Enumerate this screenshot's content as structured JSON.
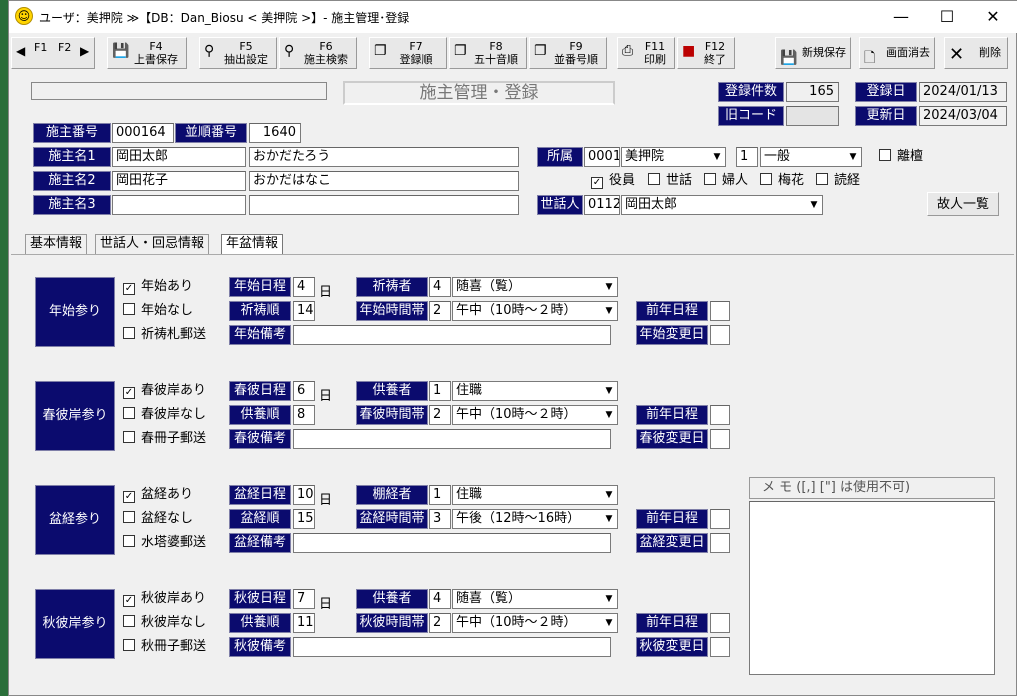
{
  "window": {
    "title": "ユーザ：美押院 ≫【DB：Dan_Biosu < 美押院 >】- 施主管理･登録",
    "controls": {
      "minimize": "—",
      "maximize": "☐",
      "close": "✕"
    }
  },
  "toolbar": {
    "nav": {
      "prev_arrow": "◀",
      "f1": "F1",
      "f2": "F2",
      "next_arrow": "▶"
    },
    "buttons": [
      {
        "key": "F4",
        "label": "上書保存",
        "icon": "save-icon"
      },
      {
        "key": "F5",
        "label": "抽出設定",
        "icon": "binoculars-icon"
      },
      {
        "key": "F6",
        "label": "施主検索",
        "icon": "binoculars-icon"
      },
      {
        "key": "F7",
        "label": "登録順",
        "icon": "copy-icon"
      },
      {
        "key": "F8",
        "label": "五十音順",
        "icon": "copy-icon"
      },
      {
        "key": "F9",
        "label": "並番号順",
        "icon": "copy-icon"
      },
      {
        "key": "F11",
        "label": "印刷",
        "icon": "printer-icon"
      },
      {
        "key": "F12",
        "label": "終了",
        "icon": "exit-icon"
      }
    ],
    "new_save": "新規保存",
    "clear_screen": "画面消去",
    "delete": "削除"
  },
  "header": {
    "screen_title": "施主管理・登録",
    "count_label": "登録件数",
    "count_value": "165",
    "old_code_label": "旧コード",
    "old_code_value": "",
    "registered_label": "登録日",
    "registered_value": "2024/01/13",
    "updated_label": "更新日",
    "updated_value": "2024/03/04"
  },
  "owner": {
    "number_label": "施主番号",
    "number_value": "000164",
    "order_label": "並順番号",
    "order_value": "1640",
    "name1_label": "施主名1",
    "name1_value": "岡田太郎",
    "name1_kana": "おかだたろう",
    "name2_label": "施主名2",
    "name2_value": "岡田花子",
    "name2_kana": "おかだはなこ",
    "name3_label": "施主名3",
    "name3_value": "",
    "name3_kana": "",
    "affiliation_label": "所属",
    "affiliation_code": "0001",
    "affiliation_name": "美押院",
    "class_code": "1",
    "class_name": "一般",
    "separated_label": "離檀",
    "roles": [
      {
        "label": "役員",
        "checked": true
      },
      {
        "label": "世話",
        "checked": false
      },
      {
        "label": "婦人",
        "checked": false
      },
      {
        "label": "梅花",
        "checked": false
      },
      {
        "label": "読経",
        "checked": false
      }
    ],
    "caretaker_label": "世話人",
    "caretaker_code": "0112",
    "caretaker_name": "岡田太郎",
    "deceased_list_button": "故人一覧"
  },
  "tabs": [
    "基本情報",
    "世話人・回忌情報",
    "年盆情報"
  ],
  "day_unit": "日",
  "sections": [
    {
      "label": "年始参り",
      "checks": [
        {
          "label": "年始あり",
          "checked": true
        },
        {
          "label": "年始なし",
          "checked": false
        },
        {
          "label": "祈祷札郵送",
          "checked": false
        }
      ],
      "date_label": "年始日程",
      "date_value": "4",
      "order_label": "祈祷順",
      "order_value": "14",
      "note_label": "年始備考",
      "note_value": "",
      "person_label": "祈祷者",
      "person_code": "4",
      "person_name": "随喜（覧）",
      "time_label": "年始時間帯",
      "time_code": "2",
      "time_value": "午中（10時～２時）",
      "prev_label": "前年日程",
      "prev_value": "",
      "change_label": "年始変更日",
      "change_value": ""
    },
    {
      "label": "春彼岸参り",
      "checks": [
        {
          "label": "春彼岸あり",
          "checked": true
        },
        {
          "label": "春彼岸なし",
          "checked": false
        },
        {
          "label": "春冊子郵送",
          "checked": false
        }
      ],
      "date_label": "春彼日程",
      "date_value": "6",
      "order_label": "供養順",
      "order_value": "8",
      "note_label": "春彼備考",
      "note_value": "",
      "person_label": "供養者",
      "person_code": "1",
      "person_name": "住職",
      "time_label": "春彼時間帯",
      "time_code": "2",
      "time_value": "午中（10時～２時）",
      "prev_label": "前年日程",
      "prev_value": "",
      "change_label": "春彼変更日",
      "change_value": ""
    },
    {
      "label": "盆経参り",
      "checks": [
        {
          "label": "盆経あり",
          "checked": true
        },
        {
          "label": "盆経なし",
          "checked": false
        },
        {
          "label": "水塔婆郵送",
          "checked": false
        }
      ],
      "date_label": "盆経日程",
      "date_value": "10",
      "order_label": "盆経順",
      "order_value": "15",
      "note_label": "盆経備考",
      "note_value": "",
      "person_label": "棚経者",
      "person_code": "1",
      "person_name": "住職",
      "time_label": "盆経時間帯",
      "time_code": "3",
      "time_value": "午後（12時～16時）",
      "prev_label": "前年日程",
      "prev_value": "",
      "change_label": "盆経変更日",
      "change_value": ""
    },
    {
      "label": "秋彼岸参り",
      "checks": [
        {
          "label": "秋彼岸あり",
          "checked": true
        },
        {
          "label": "秋彼岸なし",
          "checked": false
        },
        {
          "label": "秋冊子郵送",
          "checked": false
        }
      ],
      "date_label": "秋彼日程",
      "date_value": "7",
      "order_label": "供養順",
      "order_value": "11",
      "note_label": "秋彼備考",
      "note_value": "",
      "person_label": "供養者",
      "person_code": "4",
      "person_name": "随喜（覧）",
      "time_label": "秋彼時間帯",
      "time_code": "2",
      "time_value": "午中（10時～２時）",
      "prev_label": "前年日程",
      "prev_value": "",
      "change_label": "秋彼変更日",
      "change_value": ""
    }
  ],
  "memo": {
    "header": "メ モ  ([,] [\"] は使用不可)",
    "value": ""
  }
}
